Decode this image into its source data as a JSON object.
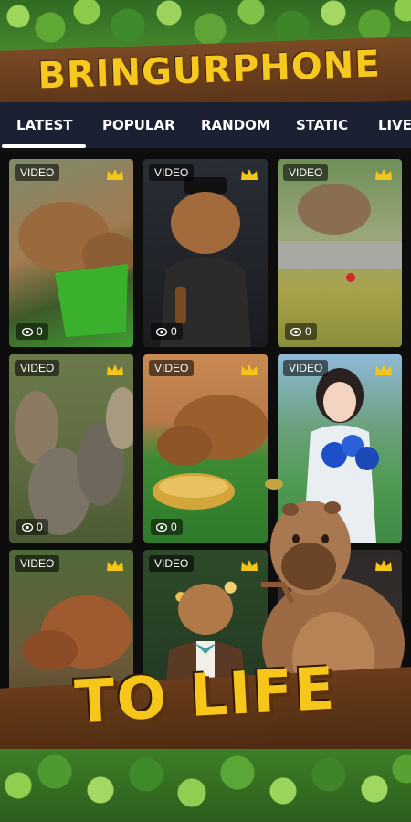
{
  "header": {
    "title": "BRINGURPHONE"
  },
  "tabs": [
    {
      "label": "LATEST",
      "active": true
    },
    {
      "label": "POPULAR",
      "active": false
    },
    {
      "label": "RANDOM",
      "active": false
    },
    {
      "label": "STATIC",
      "active": false
    },
    {
      "label": "LIVE",
      "active": false
    }
  ],
  "cards": [
    {
      "badge": "VIDEO",
      "views": "0",
      "premium": true
    },
    {
      "badge": "VIDEO",
      "views": "0",
      "premium": true
    },
    {
      "badge": "VIDEO",
      "views": "0",
      "premium": true
    },
    {
      "badge": "VIDEO",
      "views": "0",
      "premium": true
    },
    {
      "badge": "VIDEO",
      "views": "0",
      "premium": true
    },
    {
      "badge": "VIDEO",
      "views": "",
      "premium": true
    },
    {
      "badge": "VIDEO",
      "views": "",
      "premium": true
    },
    {
      "badge": "VIDEO",
      "views": "",
      "premium": true
    },
    {
      "badge": "",
      "views": "",
      "premium": true
    }
  ],
  "promo": {
    "slogan": "TO LIFE"
  },
  "colors": {
    "accent": "#f7c81e",
    "tab_bar": "#1b2033",
    "wood": "#6a3c1a"
  }
}
